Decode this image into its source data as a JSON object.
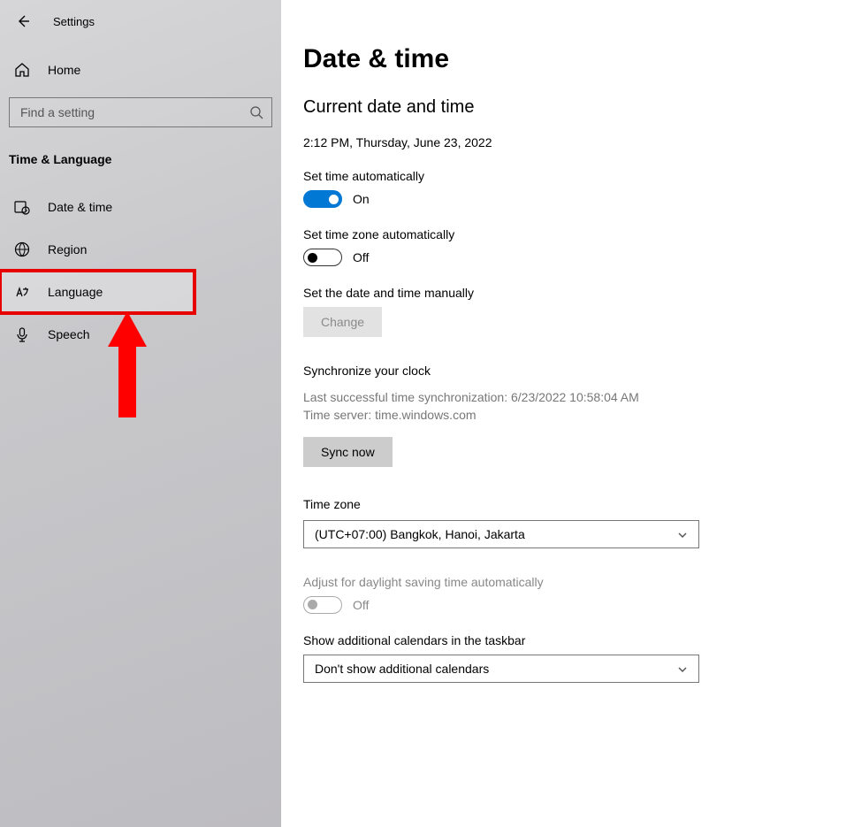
{
  "app": {
    "title": "Settings"
  },
  "sidebar": {
    "home_label": "Home",
    "search_placeholder": "Find a setting",
    "category": "Time & Language",
    "items": [
      {
        "label": "Date & time"
      },
      {
        "label": "Region"
      },
      {
        "label": "Language"
      },
      {
        "label": "Speech"
      }
    ]
  },
  "page": {
    "title": "Date & time",
    "section1_title": "Current date and time",
    "current_datetime": "2:12 PM, Thursday, June 23, 2022",
    "auto_time": {
      "label": "Set time automatically",
      "state_label": "On",
      "on": true
    },
    "auto_tz": {
      "label": "Set time zone automatically",
      "state_label": "Off",
      "on": false
    },
    "manual": {
      "label": "Set the date and time manually",
      "button": "Change"
    },
    "sync": {
      "title": "Synchronize your clock",
      "line1": "Last successful time synchronization: 6/23/2022 10:58:04 AM",
      "line2": "Time server: time.windows.com",
      "button": "Sync now"
    },
    "timezone": {
      "label": "Time zone",
      "value": "(UTC+07:00) Bangkok, Hanoi, Jakarta"
    },
    "dst": {
      "label": "Adjust for daylight saving time automatically",
      "state_label": "Off"
    },
    "calendars": {
      "label": "Show additional calendars in the taskbar",
      "value": "Don't show additional calendars"
    }
  }
}
